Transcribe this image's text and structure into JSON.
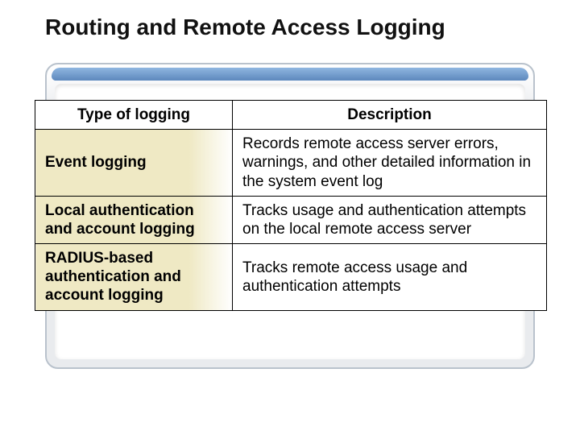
{
  "title": "Routing and Remote Access Logging",
  "chart_data": {
    "type": "table",
    "title": "Routing and Remote Access Logging",
    "headers": {
      "col1": "Type of logging",
      "col2": "Description"
    },
    "rows": [
      {
        "type": "Event logging",
        "desc": "Records remote access server errors, warnings, and other detailed information in the system event log"
      },
      {
        "type": "Local authentication and account logging",
        "desc": "Tracks usage and authentication attempts on the local remote access server"
      },
      {
        "type": "RADIUS-based authentication and account logging",
        "desc": "Tracks remote access usage and authentication attempts"
      }
    ]
  }
}
